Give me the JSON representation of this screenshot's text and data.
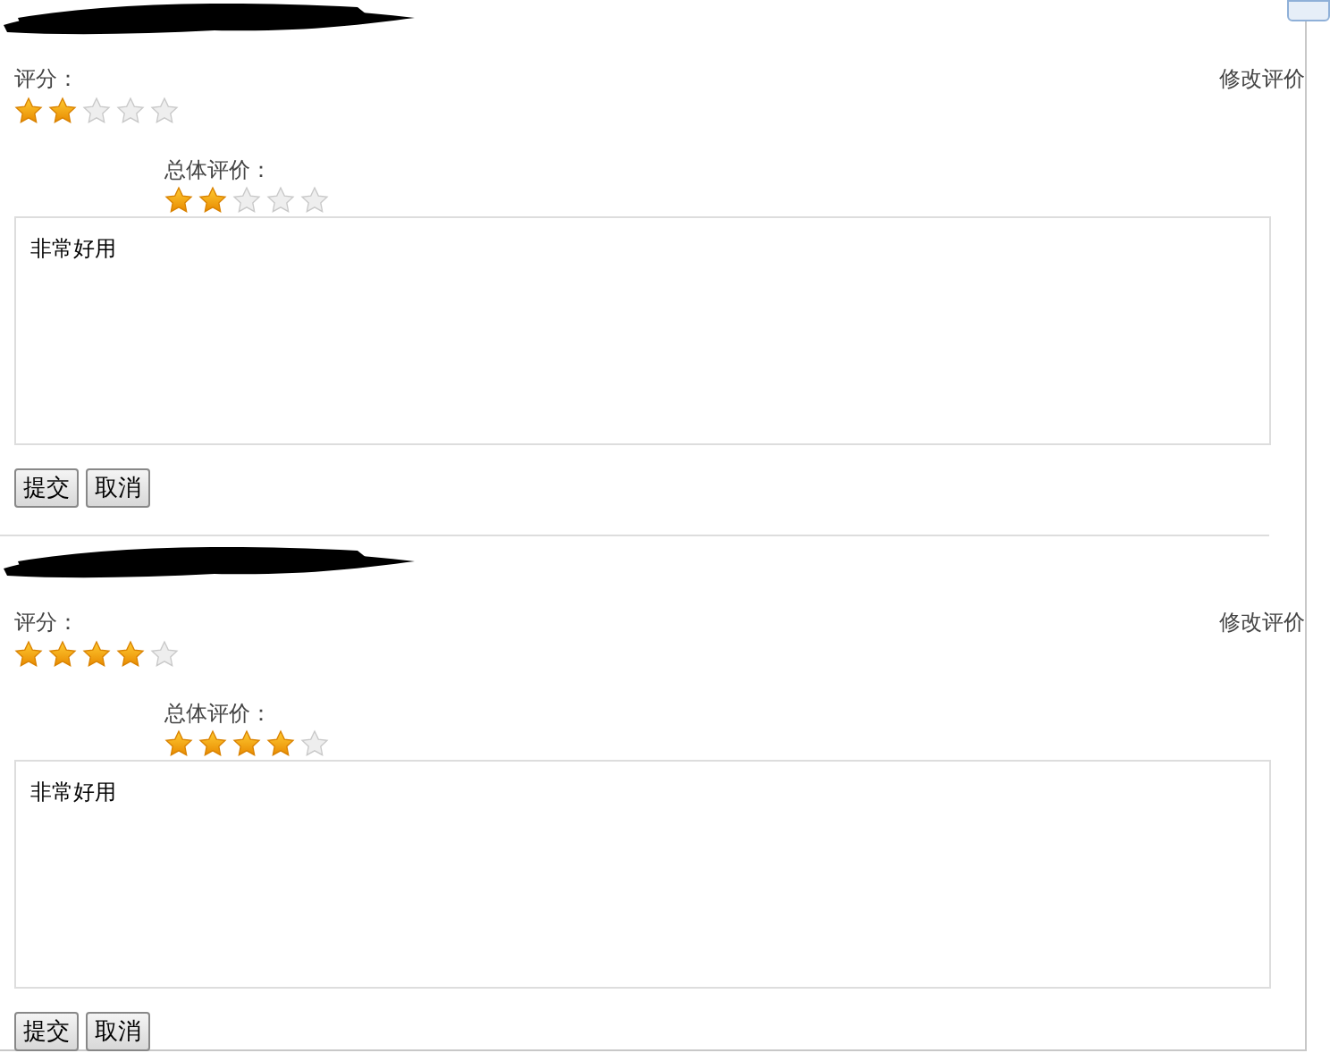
{
  "reviews": [
    {
      "rating": {
        "label": "评分：",
        "stars": 2
      },
      "edit_link": "修改评价",
      "overall": {
        "label": "总体评价：",
        "stars": 2
      },
      "comment": "非常好用",
      "buttons": [
        "提交",
        "取消"
      ]
    },
    {
      "rating": {
        "label": "评分：",
        "stars": 4
      },
      "edit_link": "修改评价",
      "overall": {
        "label": "总体评价：",
        "stars": 4
      },
      "comment": "非常好用",
      "buttons": [
        "提交",
        "取消"
      ]
    }
  ]
}
